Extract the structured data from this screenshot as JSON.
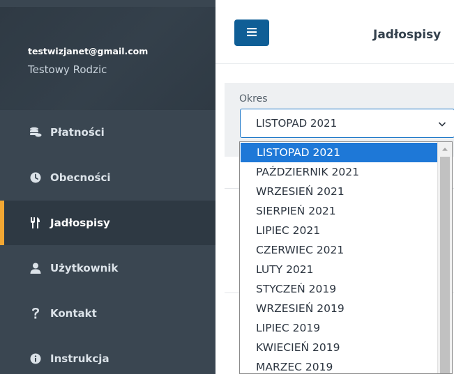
{
  "sidebar": {
    "user_email": "testwizjanet@gmail.com",
    "user_name": "Testowy Rodzic",
    "items": [
      {
        "label": "Płatności",
        "icon": "coins-icon",
        "active": false
      },
      {
        "label": "Obecności",
        "icon": "clock-icon",
        "active": false
      },
      {
        "label": "Jadłospisy",
        "icon": "utensils-icon",
        "active": true
      },
      {
        "label": "Użytkownik",
        "icon": "user-icon",
        "active": false
      },
      {
        "label": "Kontakt",
        "icon": "question-icon",
        "active": false
      },
      {
        "label": "Instrukcja",
        "icon": "info-icon",
        "active": false
      }
    ],
    "accent_color": "#f2a733"
  },
  "header": {
    "menu_icon": "hamburger-icon",
    "title": "Jadłospisy"
  },
  "filter": {
    "label": "Okres",
    "selected_value": "LISTOPAD 2021"
  },
  "dropdown": {
    "options": [
      "LISTOPAD 2021",
      "PAŹDZIERNIK 2021",
      "WRZESIEŃ 2021",
      "SIERPIEŃ 2021",
      "LIPIEC 2021",
      "CZERWIEC 2021",
      "LUTY 2021",
      "STYCZEŃ 2019",
      "WRZESIEŃ 2019",
      "LIPIEC 2019",
      "KWIECIEŃ 2019",
      "MARZEC 2019"
    ],
    "selected_index": 0
  },
  "colors": {
    "primary_button": "#0f5e96",
    "selection_highlight": "#1e78d7",
    "sidebar_bg": "#3a4651"
  }
}
